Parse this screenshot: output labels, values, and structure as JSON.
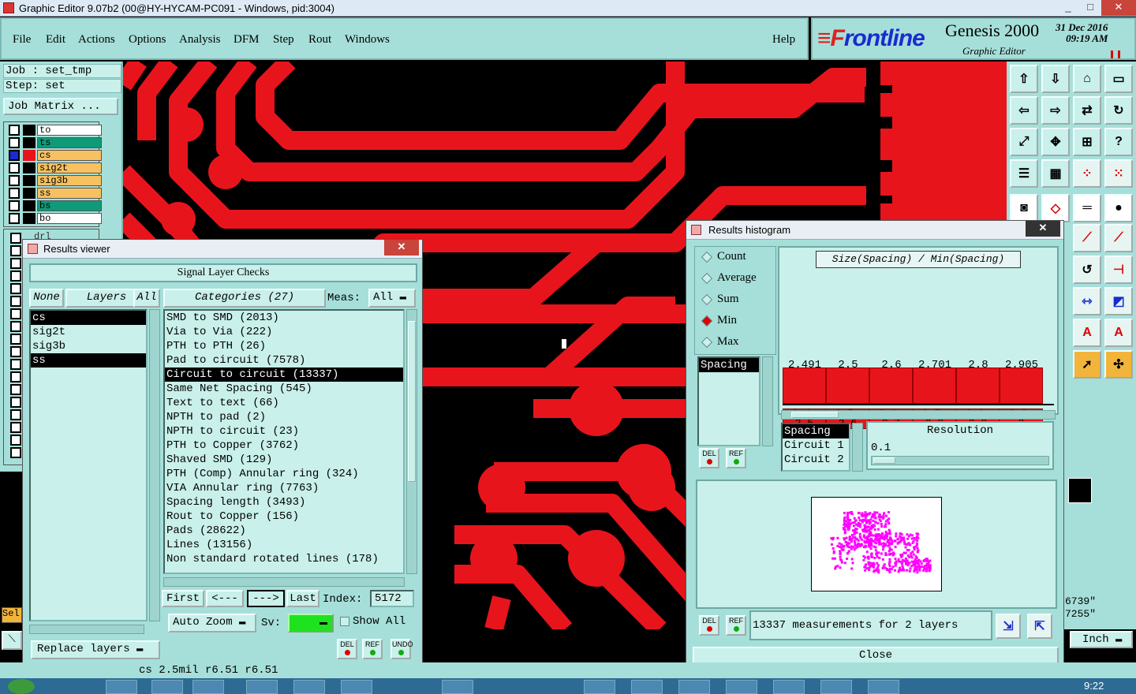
{
  "window": {
    "title": "Graphic Editor 9.07b2 (00@HY-HYCAM-PC091 - Windows, pid:3004)",
    "min": "_",
    "max": "□",
    "close": "✕"
  },
  "menu": [
    "File",
    "Edit",
    "Actions",
    "Options",
    "Analysis",
    "DFM",
    "Step",
    "Rout",
    "Windows"
  ],
  "help": "Help",
  "brand": {
    "logo_f": "≡F",
    "logo_rest": "rontline",
    "product": "Genesis 2000",
    "subtitle": "Graphic Editor",
    "date": "31 Dec 2016",
    "time": "09:19 AM"
  },
  "job": {
    "job": "Job : set_tmp",
    "step": "Step: set",
    "matrix": "Job Matrix ..."
  },
  "layers": [
    {
      "name": "to",
      "color": "#ffffff",
      "swatch": "#000000"
    },
    {
      "name": "ts",
      "color": "#0f9a78",
      "swatch": "#000000"
    },
    {
      "name": "cs",
      "color": "#f7c060",
      "swatch": "#e8141c",
      "mark": "■"
    },
    {
      "name": "sig2t",
      "color": "#f7c060",
      "swatch": "#000000"
    },
    {
      "name": "sig3b",
      "color": "#f7c060",
      "swatch": "#000000"
    },
    {
      "name": "ss",
      "color": "#f7c060",
      "swatch": "#000000"
    },
    {
      "name": "bs",
      "color": "#0f9a78",
      "swatch": "#000000"
    },
    {
      "name": "bo",
      "color": "#ffffff",
      "swatch": "#000000"
    }
  ],
  "hidden_layer": "drl",
  "results_viewer": {
    "title": "Results viewer",
    "close": "✕",
    "header": "Signal Layer Checks",
    "none": "None",
    "layers_btn": "Layers",
    "all_btn": "All",
    "categories_btn": "Categories (27)",
    "meas_label": "Meas:",
    "meas_value": "All",
    "layer_list": [
      {
        "name": "cs",
        "selected": true
      },
      {
        "name": "sig2t",
        "selected": false
      },
      {
        "name": "sig3b",
        "selected": false
      },
      {
        "name": "ss",
        "selected": true
      }
    ],
    "categories": [
      "SMD to SMD (2013)",
      "Via to Via (222)",
      "PTH to PTH (26)",
      "Pad to circuit (7578)",
      "Circuit to circuit (13337)",
      "Same Net Spacing (545)",
      "Text to text (66)",
      "NPTH to pad (2)",
      "NPTH to circuit (23)",
      "PTH to Copper (3762)",
      "Shaved SMD (129)",
      "PTH (Comp) Annular ring (324)",
      "VIA Annular ring (7763)",
      "Spacing length (3493)",
      "Rout to Copper (156)",
      "Pads (28622)",
      "Lines (13156)",
      "Non standard rotated lines (178)"
    ],
    "selected_category": 4,
    "nav": {
      "first": "First",
      "prev": "<---",
      "next": "--->",
      "last": "Last",
      "index_label": "Index:",
      "index_value": "5172"
    },
    "auto_zoom": "Auto Zoom",
    "sv_label": "Sv:",
    "show_all": "Show All",
    "replace_layers": "Replace layers",
    "del": "DEL",
    "ref": "REF",
    "undo": "UNDO"
  },
  "histogram": {
    "title": "Results histogram",
    "close": "✕",
    "modes": [
      {
        "label": "Count",
        "on": false
      },
      {
        "label": "Average",
        "on": false
      },
      {
        "label": "Sum",
        "on": false
      },
      {
        "label": "Min",
        "on": true
      },
      {
        "label": "Max",
        "on": false
      }
    ],
    "attr_list": [
      "Spacing"
    ],
    "chart_title": "Size(Spacing) / Min(Spacing)",
    "bars": [
      {
        "value": "2.491",
        "range": "2.4-2.5"
      },
      {
        "value": "2.5",
        "range": "2.5-2.6"
      },
      {
        "value": "2.6",
        "range": "2.6-2.7"
      },
      {
        "value": "2.701",
        "range": "2.7-2.8"
      },
      {
        "value": "2.8",
        "range": "2.8-2.9"
      },
      {
        "value": "2.905",
        "range": "2.9-3"
      }
    ],
    "props": [
      "Spacing",
      "Circuit 1",
      "Circuit 2"
    ],
    "resolution_label": "Resolution",
    "resolution_value": "0.1",
    "summary": "13337 measurements for 2 layers",
    "close_btn": "Close"
  },
  "status": {
    "text": "cs 2.5mil   r6.51   r6.51",
    "coord1": "6739\"",
    "coord2": "7255\"",
    "units": "Inch",
    "sel": "Sel"
  },
  "clock": "9:22",
  "colors": {
    "copper": "#e8141c",
    "panel": "#a6dfd9",
    "field": "#c9f0ea",
    "accent_green": "#1fe21f",
    "magenta": "#ff00ff"
  }
}
